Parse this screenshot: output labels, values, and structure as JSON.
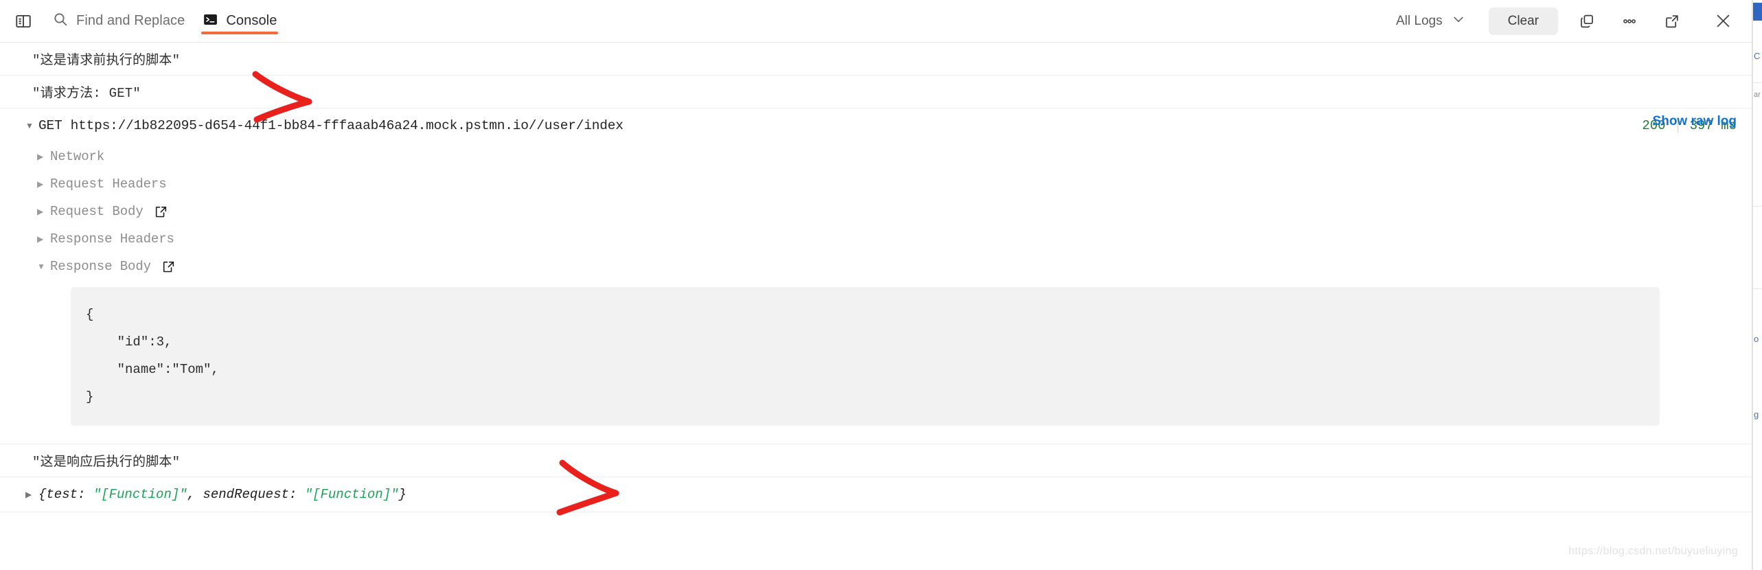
{
  "toolbar": {
    "sidebar_toggle_icon": "panel-layout-icon",
    "items": [
      {
        "icon": "search-icon",
        "label": "Find and Replace",
        "active": false
      },
      {
        "icon": "terminal-icon",
        "label": "Console",
        "active": true
      }
    ],
    "filter_label": "All Logs",
    "filter_chevron_icon": "chevron-down-icon",
    "clear_label": "Clear",
    "copy_icon": "copy-icon",
    "more_icon": "more-horizontal-icon",
    "popout_icon": "external-link-icon",
    "close_icon": "close-icon",
    "active_tab_color": "#f26b38"
  },
  "logs": {
    "pre_request_script": "\"这是请求前执行的脚本\"",
    "request_method_line": "\"请求方法: GET\"",
    "post_response_script": "\"这是响应后执行的脚本\"",
    "request": {
      "caret": "▼",
      "method": "GET",
      "url": "https://1b822095-d654-44f1-bb84-fffaaab46a24.mock.pstmn.io//user/index",
      "status_code": "200",
      "duration": "397 ms",
      "status_color": "#1f7a38",
      "show_raw_log": "Show raw log",
      "tree": [
        {
          "caret": "▶",
          "label": "Network",
          "has_external_icon": false
        },
        {
          "caret": "▶",
          "label": "Request Headers",
          "has_external_icon": false
        },
        {
          "caret": "▶",
          "label": "Request Body",
          "has_external_icon": true
        },
        {
          "caret": "▶",
          "label": "Response Headers",
          "has_external_icon": false
        },
        {
          "caret": "▼",
          "label": "Response Body",
          "has_external_icon": true
        }
      ],
      "response_body": [
        "{",
        "    \"id\":3,",
        "    \"name\":\"Tom\",",
        "}"
      ]
    },
    "script_object": {
      "caret": "▶",
      "open": "{test: ",
      "fn1": "\"[Function]\"",
      "middle": ", sendRequest: ",
      "fn2": "\"[Function]\"",
      "close": "}",
      "string_color": "#18a558"
    }
  },
  "annotations": {
    "arrow_color": "#e8211c",
    "arrow1_name": "red-chevron-annotation-top",
    "arrow2_name": "red-chevron-annotation-bottom"
  },
  "watermark": "https://blog.csdn.net/buyueliuying",
  "background_panel": {
    "fragments": [
      "C",
      "o",
      "g"
    ],
    "gray_fragment": "ar"
  }
}
